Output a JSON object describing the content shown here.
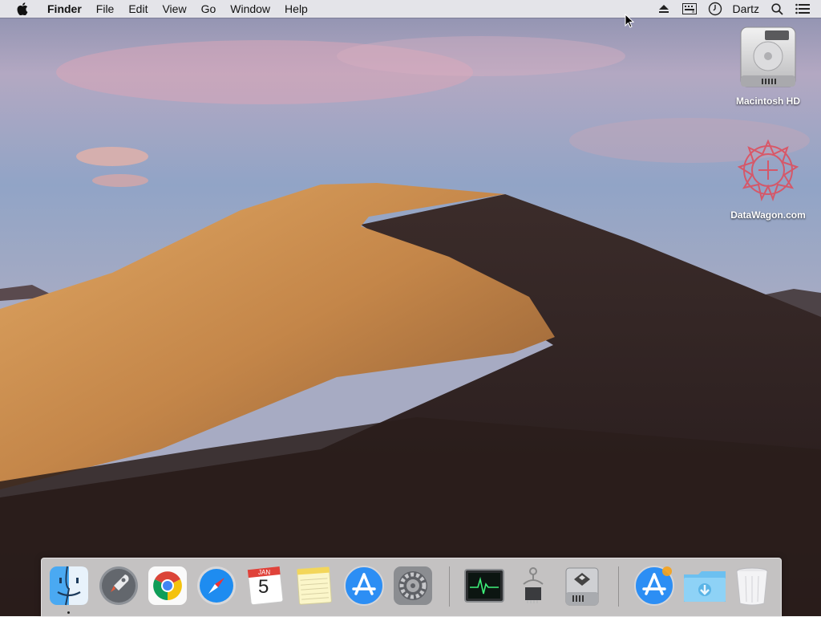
{
  "menubar": {
    "app_name": "Finder",
    "items": [
      "File",
      "Edit",
      "View",
      "Go",
      "Window",
      "Help"
    ],
    "user": "Dartz",
    "status_icons": [
      "eject-icon",
      "input-source-icon",
      "time-machine-icon",
      "spotlight-icon",
      "notification-center-icon"
    ]
  },
  "desktop": {
    "icons": [
      {
        "label": "Macintosh HD",
        "icon": "hard-drive-icon"
      },
      {
        "label": "DataWagon.com",
        "icon": "datawagon-icon"
      }
    ]
  },
  "dock": {
    "apps": [
      {
        "name": "Finder",
        "icon": "finder-icon",
        "running": true
      },
      {
        "name": "Launchpad",
        "icon": "launchpad-icon"
      },
      {
        "name": "Google Chrome",
        "icon": "chrome-icon"
      },
      {
        "name": "Safari",
        "icon": "safari-icon"
      },
      {
        "name": "Calendar",
        "icon": "calendar-icon",
        "month": "JAN",
        "day": "5"
      },
      {
        "name": "Notes",
        "icon": "notes-icon"
      },
      {
        "name": "App Store",
        "icon": "app-store-icon"
      },
      {
        "name": "System Preferences",
        "icon": "system-preferences-icon"
      },
      {
        "name": "Activity Monitor",
        "icon": "activity-monitor-icon"
      },
      {
        "name": "System Information",
        "icon": "system-information-icon"
      },
      {
        "name": "Boot Camp Assistant",
        "icon": "boot-camp-icon"
      },
      {
        "name": "App Store Downloads",
        "icon": "app-store-icon"
      },
      {
        "name": "Downloads",
        "icon": "downloads-folder-icon"
      },
      {
        "name": "Trash",
        "icon": "trash-icon"
      }
    ]
  },
  "colors": {
    "menubar_bg": "#ebebee",
    "dock_bg": "#e6e6e8",
    "dune_light": "#d59a55",
    "dune_shadow": "#2d201c"
  }
}
